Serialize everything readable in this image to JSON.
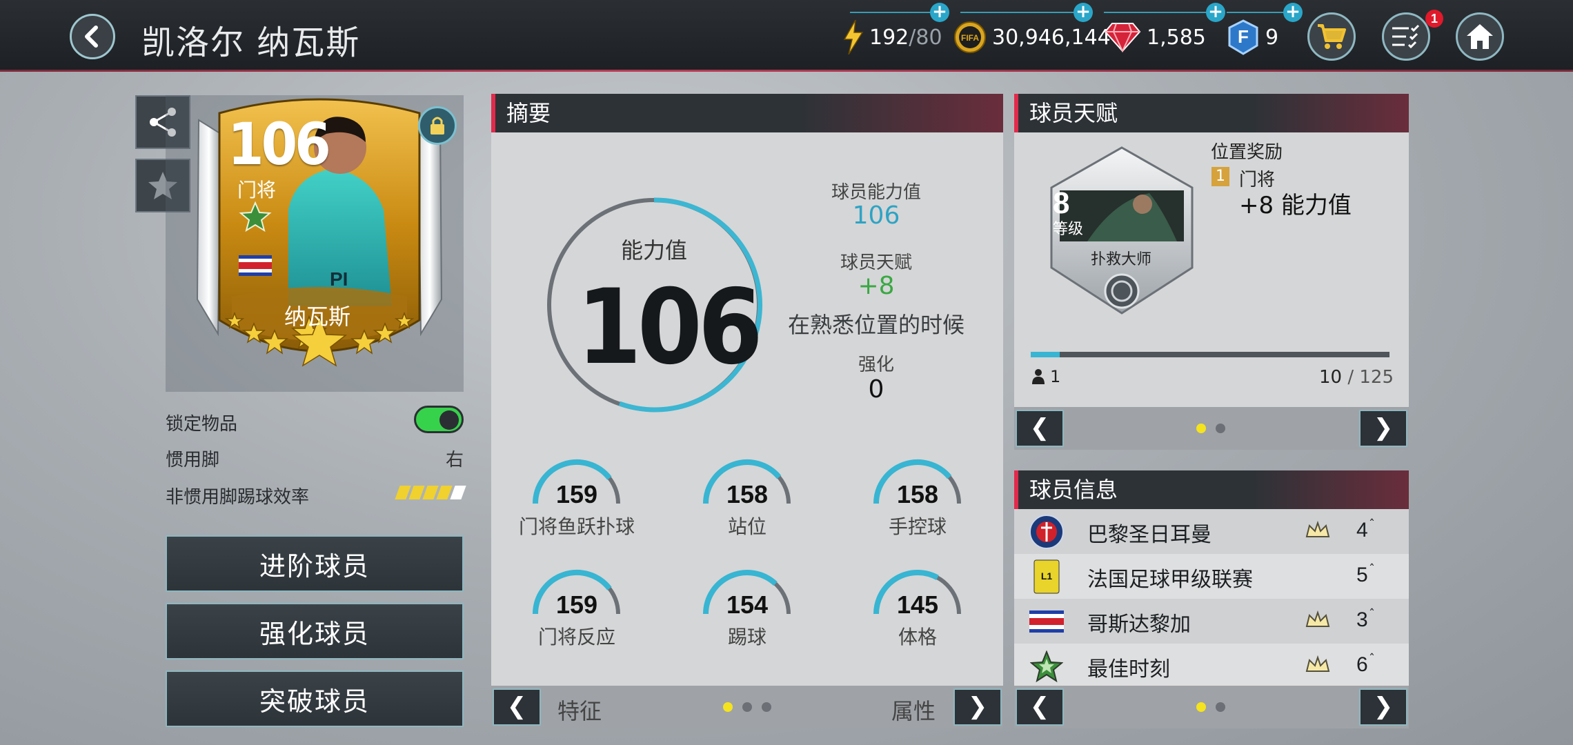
{
  "header": {
    "title": "凯洛尔 纳瓦斯",
    "energy": "192",
    "energy_max": "/80",
    "coins": "30,946,144",
    "gems": "1,585",
    "fifa_points": "9",
    "notifications_badge": "1"
  },
  "player_card": {
    "rating": "106",
    "position": "门将",
    "name": "纳瓦斯"
  },
  "properties": {
    "lock_label": "锁定物品",
    "lock_on": true,
    "foot_label": "惯用脚",
    "foot_value": "右",
    "weak_foot_label": "非惯用脚踢球效率",
    "weak_foot_stars": 4,
    "weak_foot_max": 5
  },
  "actions": {
    "advance": "进阶球员",
    "enhance": "强化球员",
    "breakthrough": "突破球员"
  },
  "summary": {
    "title": "摘要",
    "ring_label": "能力值",
    "ring_value": "106",
    "ability_label": "球员能力值",
    "ability_value": "106",
    "talent_label": "球员天赋",
    "talent_value": "+8",
    "talent_note": "在熟悉位置的时候",
    "enhance_label": "强化",
    "enhance_value": "0",
    "stats": [
      {
        "value": "159",
        "label": "门将鱼跃扑球",
        "fill": 0.79
      },
      {
        "value": "158",
        "label": "站位",
        "fill": 0.78
      },
      {
        "value": "158",
        "label": "手控球",
        "fill": 0.78
      },
      {
        "value": "159",
        "label": "门将反应",
        "fill": 0.79
      },
      {
        "value": "154",
        "label": "踢球",
        "fill": 0.74
      },
      {
        "value": "145",
        "label": "体格",
        "fill": 0.66
      }
    ],
    "nav_left": "特征",
    "nav_right": "属性"
  },
  "talent": {
    "title": "球员天赋",
    "level": "8",
    "level_word": "等级",
    "skill_name": "扑救大师",
    "reward_title": "位置奖励",
    "reward_rank": "1",
    "reward_position": "门将",
    "reward_bonus": "+8 能力值",
    "owners": "1",
    "progress_current": "10",
    "progress_total": " / 125",
    "progress_fraction": 0.08
  },
  "player_info": {
    "title": "球员信息",
    "rows": [
      {
        "name": "巴黎圣日耳曼",
        "count": "4",
        "crown": true
      },
      {
        "name": "法国足球甲级联赛",
        "count": "5",
        "crown": false
      },
      {
        "name": "哥斯达黎加",
        "count": "3",
        "crown": true
      },
      {
        "name": "最佳时刻",
        "count": "6",
        "crown": true
      }
    ]
  },
  "colors": {
    "accent_cyan": "#37b5d2",
    "accent_red": "#e22a4c",
    "talent_green": "#3aa843",
    "toggle_green": "#37d24b"
  }
}
